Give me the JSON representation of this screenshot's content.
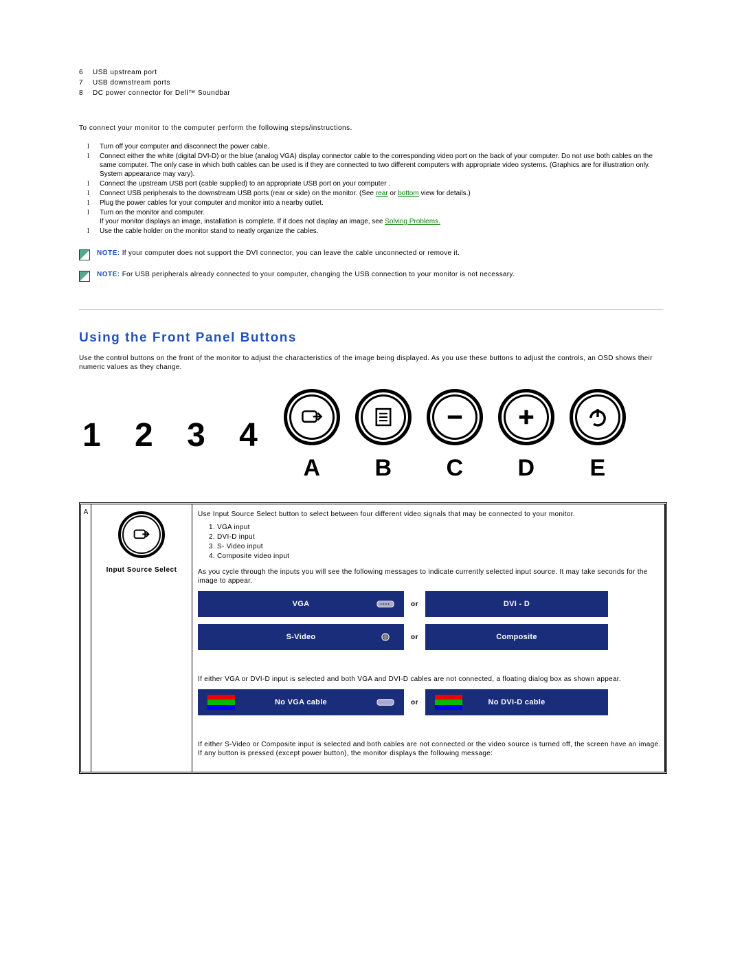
{
  "ports": [
    {
      "num": "6",
      "label": "USB upstream port"
    },
    {
      "num": "7",
      "label": "USB downstream ports"
    },
    {
      "num": "8",
      "label": "DC power connector for Dell™ Soundbar"
    }
  ],
  "connect_intro": "To connect your monitor to the computer perform the following steps/instructions.",
  "steps": {
    "s1": "Turn off your computer and disconnect the power cable.",
    "s2": "Connect either the white (digital DVI-D) or the blue (analog VGA) display connector cable to the corresponding video port on the back of your computer. Do not use both cables on the same computer. The only case in which both cables can be used is if they are connected to two different computers with appropriate video systems. (Graphics are for illustration only. System appearance may vary).",
    "s3": "Connect the upstream USB port (cable supplied) to an appropriate USB port on your computer .",
    "s4a": "Connect USB peripherals to the downstream USB ports (rear or side) on the monitor. (See ",
    "s4_link1": "rear",
    "s4_mid": " or ",
    "s4_link2": "bottom",
    "s4b": " view for details.)",
    "s5": "Plug the power cables for your computer and monitor into a nearby outlet.",
    "s6": "Turn on the monitor and computer.",
    "s6b_a": "If your monitor displays an image, installation is complete. If it does not display an image, see ",
    "s6b_link": "Solving Problems.",
    "s7": "Use the cable holder on the monitor stand to neatly organize the cables."
  },
  "note1_label": "NOTE:",
  "note1_text": " If your computer does not support the DVI connector, you can leave the cable unconnected or remove it.",
  "note2_label": "NOTE:",
  "note2_text": " For USB peripherals already connected to your computer, changing the USB connection to your monitor is not necessary.",
  "section_title": "Using the Front Panel Buttons",
  "section_intro": "Use the control buttons on the front of the monitor to adjust the characteristics of the image being displayed. As you use these buttons to adjust the controls, an OSD shows their numeric values as they change.",
  "big_numbers": "1 2 3 4",
  "buttons": [
    {
      "letter": "A",
      "icon": "input"
    },
    {
      "letter": "B",
      "icon": "menu"
    },
    {
      "letter": "C",
      "icon": "minus"
    },
    {
      "letter": "D",
      "icon": "plus"
    },
    {
      "letter": "E",
      "icon": "power"
    }
  ],
  "table": {
    "row_a": "A",
    "iss_label": "Input Source Select",
    "desc1": "Use Input Source Select button to select between four different video signals that may be connected to your monitor.",
    "inputs": [
      "VGA input",
      "DVI-D input",
      "S- Video input",
      "Composite video input"
    ],
    "desc2": "As you cycle through the inputs you will see the following messages to indicate currently selected input source. It may take seconds for the image to appear.",
    "osd": {
      "vga": "VGA",
      "dvid": "DVI - D",
      "svideo": "S-Video",
      "composite": "Composite",
      "novga": "No VGA cable",
      "nodvi": "No DVI-D cable",
      "or": "or"
    },
    "desc3": "If either VGA or DVI-D input is selected and both VGA and DVI-D cables are not connected, a floating dialog box as shown appear.",
    "desc4": "If either S-Video or Composite input is selected and both cables are not connected or the video source is turned off, the screen have an image. If any button is pressed (except power button), the monitor displays the following message:"
  }
}
